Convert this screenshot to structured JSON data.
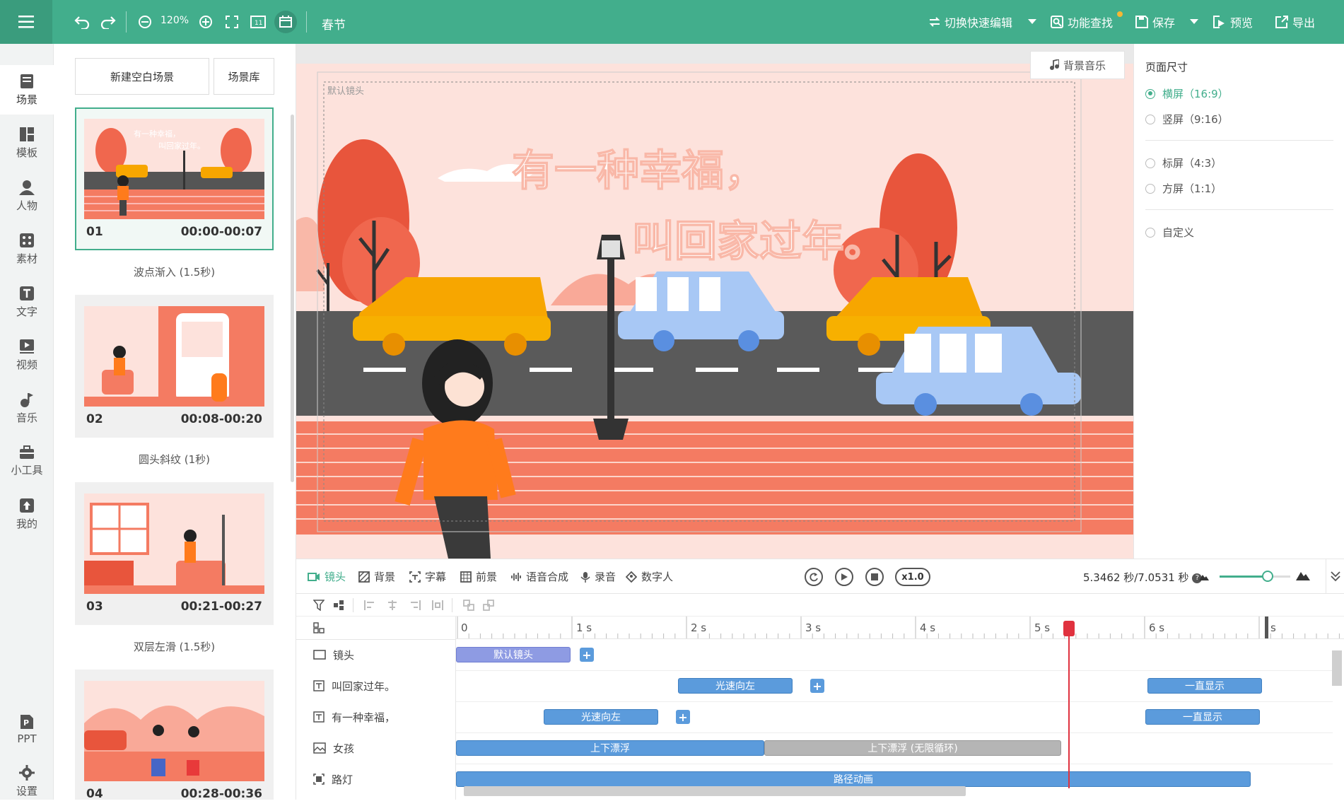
{
  "topbar": {
    "menu_icon": "hamburger-icon",
    "zoom": "120%",
    "project_name": "春节",
    "switch_label": "切换快速编辑",
    "find_label": "功能查找",
    "save_label": "保存",
    "preview_label": "预览",
    "export_label": "导出",
    "accent_color": "#42ae8c"
  },
  "sidebar": {
    "items": [
      {
        "label": "场景",
        "icon": "scene-icon"
      },
      {
        "label": "模板",
        "icon": "template-icon"
      },
      {
        "label": "人物",
        "icon": "person-icon"
      },
      {
        "label": "素材",
        "icon": "material-icon"
      },
      {
        "label": "文字",
        "icon": "text-icon"
      },
      {
        "label": "视频",
        "icon": "video-icon"
      },
      {
        "label": "音乐",
        "icon": "music-icon"
      },
      {
        "label": "小工具",
        "icon": "toolbox-icon"
      },
      {
        "label": "我的",
        "icon": "upload-icon"
      },
      {
        "label": "PPT",
        "icon": "ppt-icon"
      },
      {
        "label": "设置",
        "icon": "gear-icon"
      }
    ]
  },
  "scene_panel": {
    "new_blank_label": "新建空白场景",
    "library_label": "场景库",
    "scenes": [
      {
        "num": "01",
        "time": "00:00-00:07",
        "transition": "波点渐入 (1.5秒)"
      },
      {
        "num": "02",
        "time": "00:08-00:20",
        "transition": "圆头斜纹 (1秒)"
      },
      {
        "num": "03",
        "time": "00:21-00:27",
        "transition": "双层左滑 (1.5秒)"
      },
      {
        "num": "04",
        "time": "00:28-00:36",
        "transition": ""
      }
    ]
  },
  "canvas": {
    "camera_label": "默认镜头",
    "bgm_label": "背景音乐",
    "title_line1": "有一种幸福，",
    "title_line2": "叫回家过年。"
  },
  "page_size": {
    "title": "页面尺寸",
    "options": [
      {
        "label": "横屏（16:9）",
        "selected": true
      },
      {
        "label": "竖屏（9:16）",
        "selected": false
      },
      {
        "label": "标屏（4:3）",
        "selected": false
      },
      {
        "label": "方屏（1:1）",
        "selected": false
      },
      {
        "label": "自定义",
        "selected": false
      }
    ]
  },
  "timeline_toolbar": {
    "tabs": [
      "镜头",
      "背景",
      "字幕",
      "前景",
      "语音合成",
      "录音",
      "数字人"
    ],
    "speed": "x1.0",
    "time_readout": "5.3462 秒/7.0531 秒"
  },
  "ruler": {
    "labels": [
      "0",
      "1 s",
      "2 s",
      "3 s",
      "4 s",
      "5 s",
      "6 s",
      "s"
    ]
  },
  "tracks": [
    {
      "name": "镜头",
      "icon": "camera-icon"
    },
    {
      "name": "叫回家过年。",
      "icon": "text-box-icon"
    },
    {
      "name": "有一种幸福，",
      "icon": "text-box-icon"
    },
    {
      "name": "女孩",
      "icon": "image-icon"
    },
    {
      "name": "路灯",
      "icon": "crop-icon"
    }
  ],
  "clips": {
    "camera_default": "默认镜头",
    "t1_a": "光速向左",
    "t1_b": "一直显示",
    "t2_a": "光速向左",
    "t2_b": "一直显示",
    "girl_a": "上下漂浮",
    "girl_b": "上下漂浮 (无限循环)",
    "lamp_a": "路径动画"
  }
}
